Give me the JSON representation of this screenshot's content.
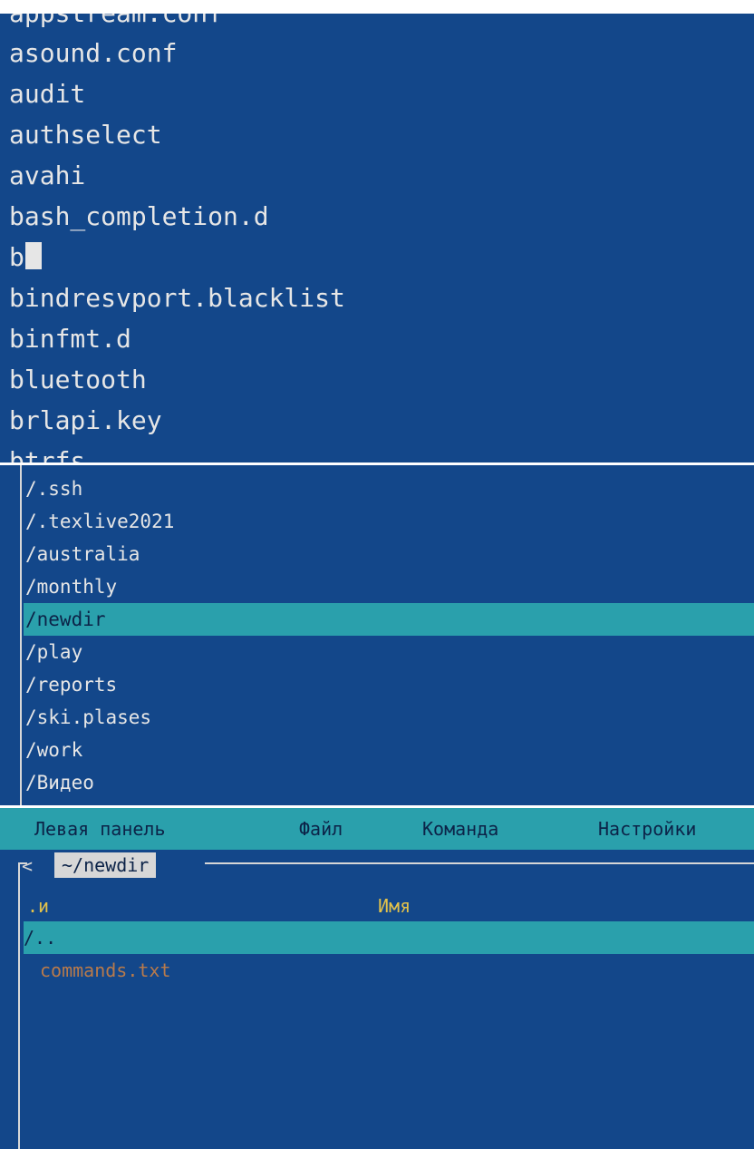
{
  "terminal": {
    "lines": [
      "appstream.conf",
      "asound.conf",
      "audit",
      "authselect",
      "avahi",
      "bash_completion.d",
      "b",
      "bindresvport.blacklist",
      "binfmt.d",
      "bluetooth",
      "brlapi.key",
      "btrfs"
    ],
    "cursor_line_index": 6
  },
  "hotlist": {
    "items": [
      "/.ssh",
      "/.texlive2021",
      "/australia",
      "/monthly",
      "/newdir",
      "/play",
      "/reports",
      "/ski.plases",
      "/work",
      "/Видео"
    ],
    "selected_index": 4
  },
  "mc": {
    "menu": [
      "Левая панель",
      "Файл",
      "Команда",
      "Настройки"
    ],
    "back_arrow": "<",
    "path": "~/newdir",
    "columns": {
      "sort": ".и",
      "name": "Имя"
    },
    "rows": [
      "/..",
      "commands.txt"
    ],
    "selected_index": 0
  },
  "colors": {
    "background": "#13478a",
    "highlight": "#2aa0ac",
    "text": "#e6e6e6",
    "header": "#e3c24a",
    "file": "#b87a4b"
  }
}
